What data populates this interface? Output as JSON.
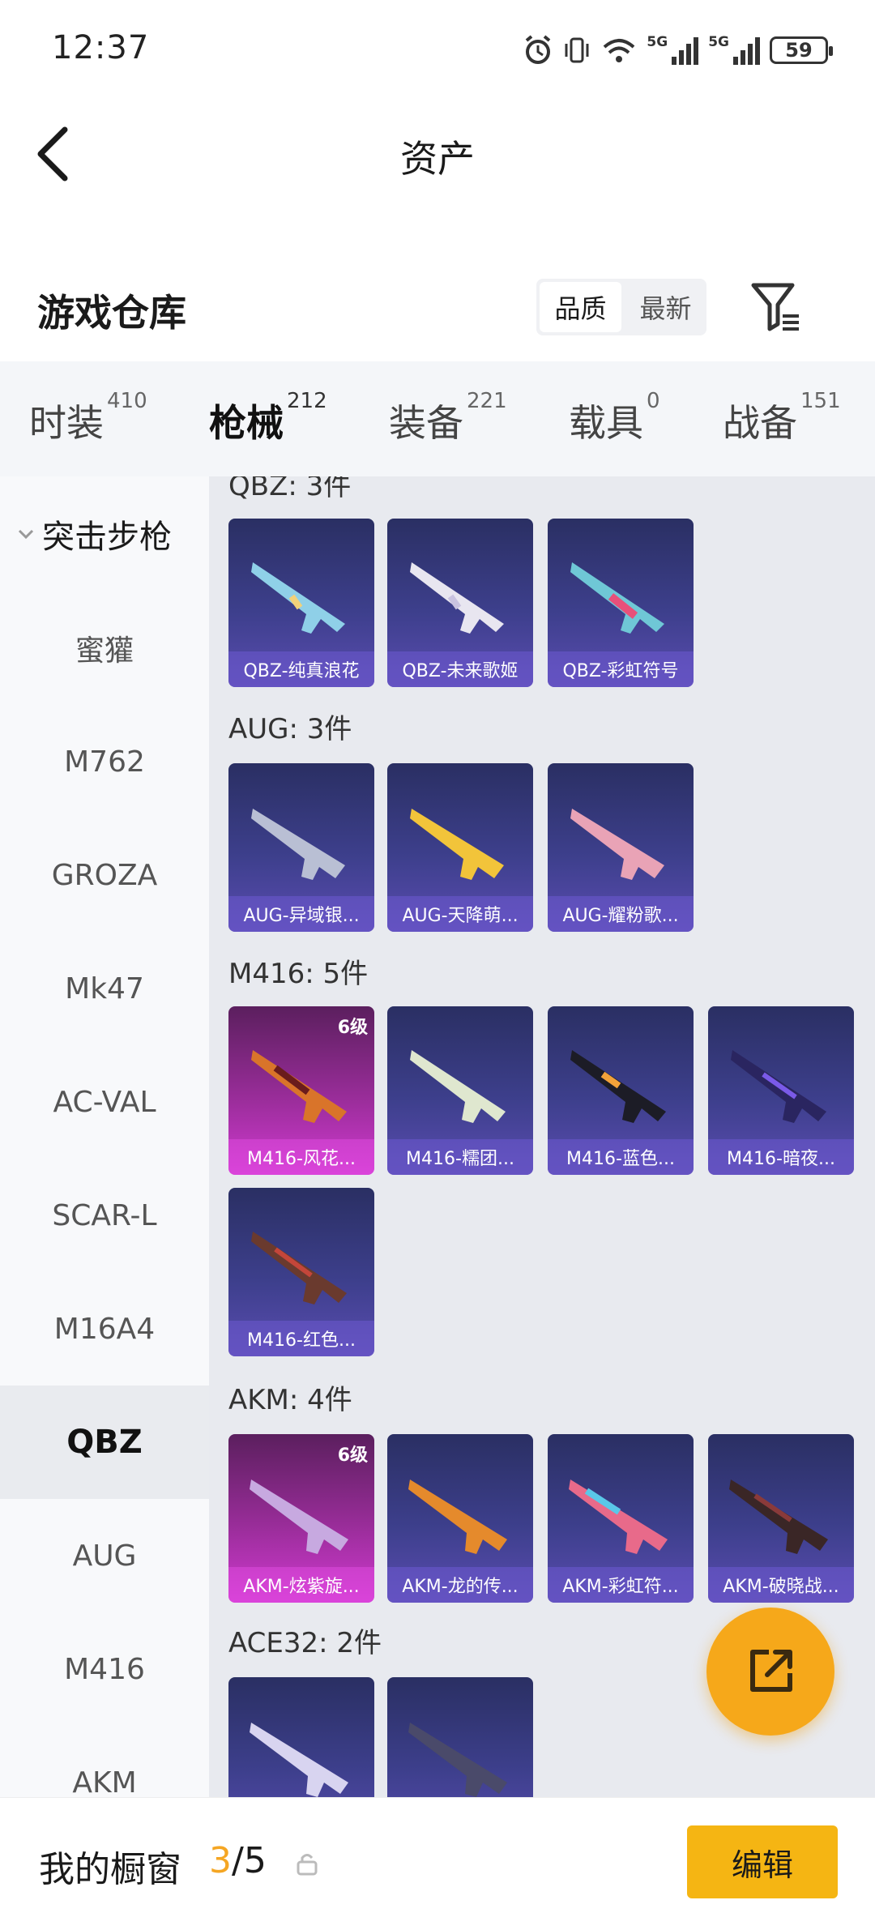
{
  "status": {
    "time": "12:37",
    "signal_1": "5G",
    "signal_2": "5G",
    "battery": "59"
  },
  "header": {
    "title": "资产"
  },
  "section": {
    "title": "游戏仓库",
    "sort_options": [
      "品质",
      "最新"
    ],
    "active_sort": "品质"
  },
  "tabs": [
    {
      "label": "时装",
      "count": "410"
    },
    {
      "label": "枪械",
      "count": "212",
      "active": true
    },
    {
      "label": "装备",
      "count": "221"
    },
    {
      "label": "载具",
      "count": "0"
    },
    {
      "label": "战备",
      "count": "151"
    }
  ],
  "sidebar": {
    "group": "突击步枪",
    "items": [
      "蜜獾",
      "M762",
      "GROZA",
      "Mk47",
      "AC-VAL",
      "SCAR-L",
      "M16A4",
      "QBZ",
      "AUG",
      "M416",
      "AKM"
    ],
    "selected": "QBZ"
  },
  "groups": [
    {
      "title": "QBZ: 3件",
      "items": [
        {
          "name": "QBZ-纯真浪花"
        },
        {
          "name": "QBZ-未来歌姬"
        },
        {
          "name": "QBZ-彩虹符号"
        }
      ]
    },
    {
      "title": "AUG: 3件",
      "items": [
        {
          "name": "AUG-异域银..."
        },
        {
          "name": "AUG-天降萌..."
        },
        {
          "name": "AUG-耀粉歌..."
        }
      ]
    },
    {
      "title": "M416: 5件",
      "items": [
        {
          "name": "M416-风花...",
          "level": "6级"
        },
        {
          "name": "M416-糯团..."
        },
        {
          "name": "M416-蓝色..."
        },
        {
          "name": "M416-暗夜..."
        },
        {
          "name": "M416-红色..."
        }
      ]
    },
    {
      "title": "AKM: 4件",
      "items": [
        {
          "name": "AKM-炫紫旋...",
          "level": "6级"
        },
        {
          "name": "AKM-龙的传..."
        },
        {
          "name": "AKM-彩虹符..."
        },
        {
          "name": "AKM-破晓战..."
        }
      ]
    },
    {
      "title": "ACE32: 2件",
      "items": [
        {
          "name": ""
        },
        {
          "name": ""
        }
      ]
    }
  ],
  "bottom": {
    "label": "我的橱窗",
    "current": "3",
    "total": "/5",
    "edit": "编辑"
  },
  "colors": {
    "accent": "#f5a623",
    "card_normal": "#3d3f8c",
    "card_gold": "#9a2d9a"
  },
  "icons": {
    "back": "chevron-left-icon",
    "filter": "filter-icon",
    "lock": "lock-icon",
    "share": "share-out-icon"
  }
}
